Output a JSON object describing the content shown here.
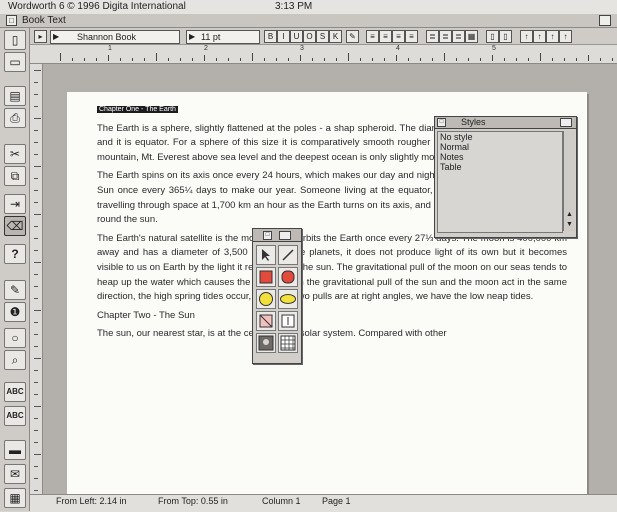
{
  "menubar": {
    "app_label": "Wordworth 6  © 1996 Digita International",
    "clock": "3:13 PM"
  },
  "window": {
    "title": "Book Text"
  },
  "toolbar": {
    "font_value": "Shannon Book",
    "size_value": "11 pt",
    "style_buttons": [
      "B",
      "I",
      "U",
      "O",
      "S",
      "K"
    ]
  },
  "ruler": {
    "numbers": [
      "1",
      "2",
      "3",
      "4",
      "5"
    ]
  },
  "document": {
    "heading_selected": "Chapter One - The Earth",
    "paragraphs": [
      "The Earth is a sphere, slightly flattened at the poles - a shap spheroid. The diameter at the pole is 127,414 km and it is equator. For a sphere of this size it is comparatively smooth rougher than a billiard ball. The highest mountain, Mt. Everest above sea level and the deepest ocean is only slightly more",
      "The Earth spins on its axis once every 24 hours, which makes our day and night. At the same time, it orbits the Sun once every 365¼ days to make our year. Someone living at the equator, even when they are asleep, is travelling through space at 1,700 km an hour as the Earth turns on its axis, and at 100,000 km/hour as it travels round the sun.",
      "The Earth's natural satellite is the moon, which orbits the Earth once every 27⅓ days. The moon is 400,000 km away and has a diameter of 3,500 km. Like the planets, it does not produce light of its own but it becomes visible to us on Earth by the light it reflects from the sun. The gravitational pull of the moon on our seas tends to heap up the water which causes the tides. When the gravitational pull of the sun and the moon act in the same direction, the high spring tides occur, when the two pulls are at right angles, we have the low neap tides."
    ],
    "heading2": "Chapter Two - The Sun",
    "paragraph_last": "The sun, our nearest star, is at the centre of our solar system. Compared with other"
  },
  "styles_palette": {
    "title": "Styles",
    "items": [
      "No style",
      "Normal",
      "Notes",
      "Table"
    ]
  },
  "status": {
    "from_left": "From Left: 2.14 in",
    "from_top": "From Top: 0.55 in",
    "column": "Column 1",
    "page": "Page 1"
  },
  "colors": {
    "highlight": "#1c1c1c",
    "palette_red": "#e24a3b",
    "palette_yellow": "#f2e13a"
  }
}
